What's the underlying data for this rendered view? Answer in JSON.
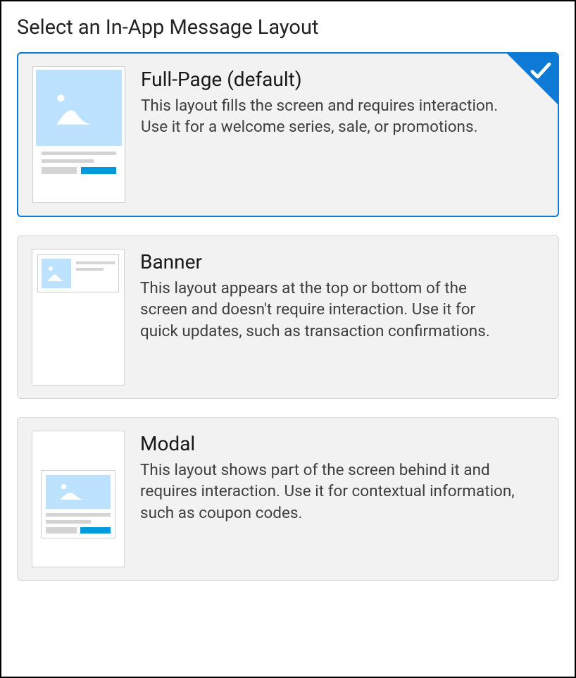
{
  "heading": "Select an In-App Message Layout",
  "options": [
    {
      "title": "Full-Page (default)",
      "desc": "This layout fills the screen and requires interaction. Use it for a welcome series, sale, or promotions.",
      "selected": true
    },
    {
      "title": "Banner",
      "desc": "This layout appears at the top or bottom of the screen and doesn't require interaction. Use it for quick updates, such as transaction confirmations.",
      "selected": false
    },
    {
      "title": "Modal",
      "desc": "This layout shows part of the screen behind it and requires interaction. Use it for contextual information, such as coupon codes.",
      "selected": false
    }
  ]
}
